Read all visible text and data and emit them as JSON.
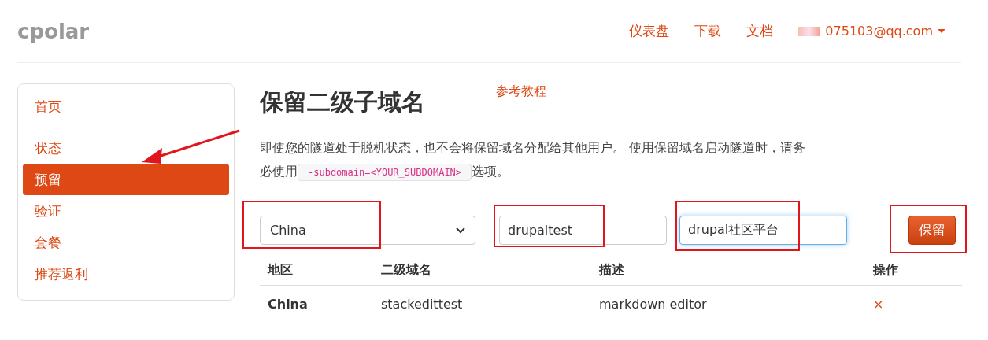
{
  "brand": "cpolar",
  "nav": [
    {
      "label": "仪表盘"
    },
    {
      "label": "下载"
    },
    {
      "label": "文档"
    }
  ],
  "account": {
    "email": "075103@qq.com"
  },
  "sidebar": {
    "items": [
      {
        "label": "首页",
        "selected": false
      },
      {
        "label": "状态",
        "selected": false
      },
      {
        "label": "预留",
        "selected": true
      },
      {
        "label": "验证",
        "selected": false
      },
      {
        "label": "套餐",
        "selected": false
      },
      {
        "label": "推荐返利",
        "selected": false
      }
    ]
  },
  "page": {
    "title": "保留二级子域名",
    "tutorial_link": "参考教程",
    "description_before": "即使您的隧道处于脱机状态，也不会将保留域名分配给其他用户。 使用保留域名启动隧道时，请务必使用",
    "code": "-subdomain=<YOUR_SUBDOMAIN>",
    "description_after": "选项。"
  },
  "form": {
    "region": "China",
    "subdomain": "drupaltest",
    "description": "drupal社区平台",
    "submit": "保留"
  },
  "table": {
    "columns": [
      "地区",
      "二级域名",
      "描述",
      "操作"
    ],
    "rows": [
      {
        "region": "China",
        "subdomain": "stackedittest",
        "description": "markdown editor",
        "action": "×"
      }
    ]
  }
}
